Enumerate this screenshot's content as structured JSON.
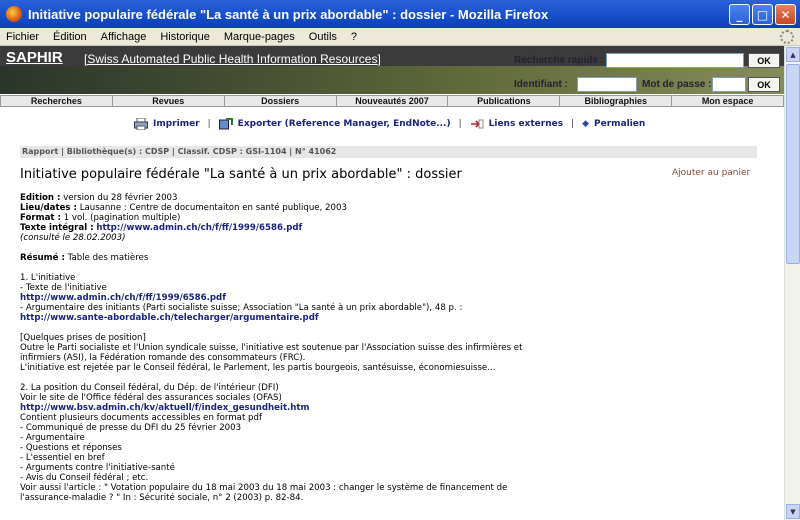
{
  "window": {
    "title": "Initiative populaire fédérale \"La santé à un prix abordable\" : dossier - Mozilla Firefox",
    "controls": {
      "minimize": "_",
      "maximize": "□",
      "close": "✕"
    }
  },
  "menu": [
    "Fichier",
    "Édition",
    "Affichage",
    "Historique",
    "Marque-pages",
    "Outils",
    "?"
  ],
  "header": {
    "logo": "SAPHIR",
    "subtitle": "[Swiss Automated Public Health Information Resources]",
    "quick_search_label": "Recherche rapide :",
    "login_label": "Identifiant :",
    "password_label": "Mot de passe :",
    "ok": "OK"
  },
  "nav_tabs": [
    "Recherches",
    "Revues",
    "Dossiers",
    "Nouveautés 2007",
    "Publications",
    "Bibliographies",
    "Mon espace"
  ],
  "toolbar": {
    "print": "Imprimer",
    "export": "Exporter (Reference Manager, EndNote...)",
    "links": "Liens externes",
    "permalink": "Permalien",
    "sep": "|"
  },
  "breadcrumb": "Rapport | Bibliothèque(s) : CDSP | Classif. CDSP : GSI-1104 | N° 41062",
  "doc": {
    "title": "Initiative populaire fédérale \"La santé à un prix abordable\" : dossier",
    "add_to_cart": "Ajouter au panier",
    "edition_label": "Edition :",
    "edition_value": "version du 28 février 2003",
    "place_label": "Lieu/dates :",
    "place_value": "Lausanne : Centre de documentaiton en santé publique, 2003",
    "format_label": "Format :",
    "format_value": "1 vol. (pagination multiple)",
    "fulltext_label": "Texte intégral :",
    "fulltext_url": "http://www.admin.ch/ch/f/ff/1999/6586.pdf",
    "consulted": "(consulté le 28.02.2003)",
    "summary_label": "Résumé :",
    "summary_value": "Table des matières",
    "s1_title": "1. L'initiative",
    "s1_l1": "- Texte de l'initiative",
    "s1_url1": "http://www.admin.ch/ch/f/ff/1999/6586.pdf",
    "s1_l2": "- Argumentaire des initiants (Parti socialiste suisse; Association \"La santé à un prix abordable\"), 48 p. :",
    "s1_url2": "http://www.sante-abordable.ch/telecharger/argumentaire.pdf",
    "pos_title": "[Quelques prises de position]",
    "pos_l1": "Outre le Parti socialiste et l'Union syndicale suisse, l'initiative est soutenue par l'Association suisse des infirmières et",
    "pos_l2": "infirmiers (ASI), la Fédération romande des consommateurs (FRC).",
    "pos_l3": "L'initiative est rejetée par le Conseil fédéral, le Parlement, les partis bourgeois, santésuisse, économiesuisse...",
    "s2_title": "2. La position du Conseil fédéral, du Dép. de l'intérieur (DFI)",
    "s2_l1": "Voir le site de l'Office fédéral des assurances sociales (OFAS)",
    "s2_url": "http://www.bsv.admin.ch/kv/aktuell/f/index_gesundheit.htm",
    "s2_l2": "Contient plusieurs documents accessibles en format pdf",
    "s2_l3": "- Communiqué de presse du DFI du 25 février 2003",
    "s2_l4": "- Argumentaire",
    "s2_l5": "- Questions et réponses",
    "s2_l6": "- L'essentiel en bref",
    "s2_l7": "- Arguments contre l'initiative-santé",
    "s2_l8": "- Avis du Conseil fédéral ; etc.",
    "s2_l9": "Voir aussi l'article : \" Votation populaire du 18 mai 2003 du 18 mai 2003 : changer le système de financement de",
    "s2_l10": "l'assurance-maladie ? \" In : Sécurité sociale, n° 2 (2003) p. 82-84."
  }
}
